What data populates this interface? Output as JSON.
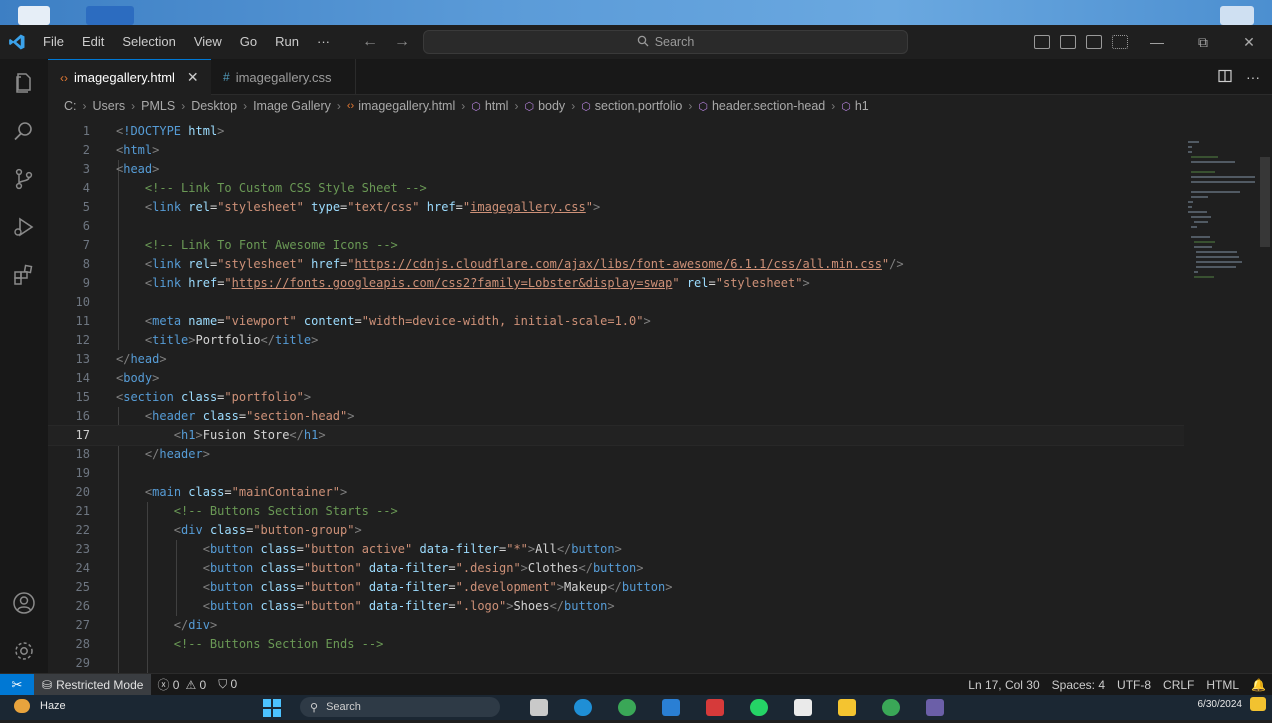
{
  "titlebar": {
    "menus": [
      "File",
      "Edit",
      "Selection",
      "View",
      "Go",
      "Run",
      "···"
    ],
    "search_label": "Search",
    "back_arrow": "←",
    "forward_arrow": "→"
  },
  "tabs": [
    {
      "label": "imagegallery.html",
      "icon": "‹›",
      "active": true
    },
    {
      "label": "imagegallery.css",
      "icon": "#",
      "active": false
    }
  ],
  "breadcrumb": [
    "C:",
    "Users",
    "PMLS",
    "Desktop",
    "Image Gallery",
    "imagegallery.html",
    "html",
    "body",
    "section.portfolio",
    "header.section-head",
    "h1"
  ],
  "editor": {
    "current_line": 17,
    "lines": [
      {
        "n": "1",
        "tokens": [
          [
            "t-tag",
            "<"
          ],
          [
            "t-doc",
            "!DOCTYPE"
          ],
          [
            "t-txt",
            " "
          ],
          [
            "t-attr",
            "html"
          ],
          [
            "t-tag",
            ">"
          ]
        ]
      },
      {
        "n": "2",
        "tokens": [
          [
            "t-tag",
            "<"
          ],
          [
            "t-name",
            "html"
          ],
          [
            "t-tag",
            ">"
          ]
        ]
      },
      {
        "n": "3",
        "tokens": [
          [
            "t-tag",
            "<"
          ],
          [
            "t-name",
            "head"
          ],
          [
            "t-tag",
            ">"
          ]
        ]
      },
      {
        "n": "4",
        "tokens": [
          [
            "t-txt",
            "    "
          ],
          [
            "t-com",
            "<!-- Link To Custom CSS Style Sheet -->"
          ]
        ]
      },
      {
        "n": "5",
        "tokens": [
          [
            "t-txt",
            "    "
          ],
          [
            "t-tag",
            "<"
          ],
          [
            "t-name",
            "link"
          ],
          [
            "t-txt",
            " "
          ],
          [
            "t-attr",
            "rel"
          ],
          [
            "t-txt",
            "="
          ],
          [
            "t-str",
            "\"stylesheet\""
          ],
          [
            "t-txt",
            " "
          ],
          [
            "t-attr",
            "type"
          ],
          [
            "t-txt",
            "="
          ],
          [
            "t-str",
            "\"text/css\""
          ],
          [
            "t-txt",
            " "
          ],
          [
            "t-attr",
            "href"
          ],
          [
            "t-txt",
            "="
          ],
          [
            "t-str",
            "\""
          ],
          [
            "t-link",
            "imagegallery.css"
          ],
          [
            "t-str",
            "\""
          ],
          [
            "t-tag",
            ">"
          ]
        ]
      },
      {
        "n": "6",
        "tokens": []
      },
      {
        "n": "7",
        "tokens": [
          [
            "t-txt",
            "    "
          ],
          [
            "t-com",
            "<!-- Link To Font Awesome Icons -->"
          ]
        ]
      },
      {
        "n": "8",
        "tokens": [
          [
            "t-txt",
            "    "
          ],
          [
            "t-tag",
            "<"
          ],
          [
            "t-name",
            "link"
          ],
          [
            "t-txt",
            " "
          ],
          [
            "t-attr",
            "rel"
          ],
          [
            "t-txt",
            "="
          ],
          [
            "t-str",
            "\"stylesheet\""
          ],
          [
            "t-txt",
            " "
          ],
          [
            "t-attr",
            "href"
          ],
          [
            "t-txt",
            "="
          ],
          [
            "t-str",
            "\""
          ],
          [
            "t-link",
            "https://cdnjs.cloudflare.com/ajax/libs/font-awesome/6.1.1/css/all.min.css"
          ],
          [
            "t-str",
            "\""
          ],
          [
            "t-tag",
            "/>"
          ]
        ]
      },
      {
        "n": "9",
        "tokens": [
          [
            "t-txt",
            "    "
          ],
          [
            "t-tag",
            "<"
          ],
          [
            "t-name",
            "link"
          ],
          [
            "t-txt",
            " "
          ],
          [
            "t-attr",
            "href"
          ],
          [
            "t-txt",
            "="
          ],
          [
            "t-str",
            "\""
          ],
          [
            "t-link",
            "https://fonts.googleapis.com/css2?family=Lobster&display=swap"
          ],
          [
            "t-str",
            "\""
          ],
          [
            "t-txt",
            " "
          ],
          [
            "t-attr",
            "rel"
          ],
          [
            "t-txt",
            "="
          ],
          [
            "t-str",
            "\"stylesheet\""
          ],
          [
            "t-tag",
            ">"
          ]
        ]
      },
      {
        "n": "10",
        "tokens": []
      },
      {
        "n": "11",
        "tokens": [
          [
            "t-txt",
            "    "
          ],
          [
            "t-tag",
            "<"
          ],
          [
            "t-name",
            "meta"
          ],
          [
            "t-txt",
            " "
          ],
          [
            "t-attr",
            "name"
          ],
          [
            "t-txt",
            "="
          ],
          [
            "t-str",
            "\"viewport\""
          ],
          [
            "t-txt",
            " "
          ],
          [
            "t-attr",
            "content"
          ],
          [
            "t-txt",
            "="
          ],
          [
            "t-str",
            "\"width=device-width, initial-scale=1.0\""
          ],
          [
            "t-tag",
            ">"
          ]
        ]
      },
      {
        "n": "12",
        "tokens": [
          [
            "t-txt",
            "    "
          ],
          [
            "t-tag",
            "<"
          ],
          [
            "t-name",
            "title"
          ],
          [
            "t-tag",
            ">"
          ],
          [
            "t-txt",
            "Portfolio"
          ],
          [
            "t-tag",
            "</"
          ],
          [
            "t-name",
            "title"
          ],
          [
            "t-tag",
            ">"
          ]
        ]
      },
      {
        "n": "13",
        "tokens": [
          [
            "t-tag",
            "</"
          ],
          [
            "t-name",
            "head"
          ],
          [
            "t-tag",
            ">"
          ]
        ]
      },
      {
        "n": "14",
        "tokens": [
          [
            "t-tag",
            "<"
          ],
          [
            "t-name",
            "body"
          ],
          [
            "t-tag",
            ">"
          ]
        ]
      },
      {
        "n": "15",
        "tokens": [
          [
            "t-tag",
            "<"
          ],
          [
            "t-name",
            "section"
          ],
          [
            "t-txt",
            " "
          ],
          [
            "t-attr",
            "class"
          ],
          [
            "t-txt",
            "="
          ],
          [
            "t-str",
            "\"portfolio\""
          ],
          [
            "t-tag",
            ">"
          ]
        ]
      },
      {
        "n": "16",
        "tokens": [
          [
            "t-txt",
            "    "
          ],
          [
            "t-tag",
            "<"
          ],
          [
            "t-name",
            "header"
          ],
          [
            "t-txt",
            " "
          ],
          [
            "t-attr",
            "class"
          ],
          [
            "t-txt",
            "="
          ],
          [
            "t-str",
            "\"section-head\""
          ],
          [
            "t-tag",
            ">"
          ]
        ]
      },
      {
        "n": "17",
        "tokens": [
          [
            "t-txt",
            "        "
          ],
          [
            "t-tag",
            "<"
          ],
          [
            "t-name",
            "h1"
          ],
          [
            "t-tag",
            ">"
          ],
          [
            "t-txt",
            "Fusion Store"
          ],
          [
            "t-tag",
            "</"
          ],
          [
            "t-name",
            "h1"
          ],
          [
            "t-tag",
            ">"
          ]
        ]
      },
      {
        "n": "18",
        "tokens": [
          [
            "t-txt",
            "    "
          ],
          [
            "t-tag",
            "</"
          ],
          [
            "t-name",
            "header"
          ],
          [
            "t-tag",
            ">"
          ]
        ]
      },
      {
        "n": "19",
        "tokens": []
      },
      {
        "n": "20",
        "tokens": [
          [
            "t-txt",
            "    "
          ],
          [
            "t-tag",
            "<"
          ],
          [
            "t-name",
            "main"
          ],
          [
            "t-txt",
            " "
          ],
          [
            "t-attr",
            "class"
          ],
          [
            "t-txt",
            "="
          ],
          [
            "t-str",
            "\"mainContainer\""
          ],
          [
            "t-tag",
            ">"
          ]
        ]
      },
      {
        "n": "21",
        "tokens": [
          [
            "t-txt",
            "        "
          ],
          [
            "t-com",
            "<!-- Buttons Section Starts -->"
          ]
        ]
      },
      {
        "n": "22",
        "tokens": [
          [
            "t-txt",
            "        "
          ],
          [
            "t-tag",
            "<"
          ],
          [
            "t-name",
            "div"
          ],
          [
            "t-txt",
            " "
          ],
          [
            "t-attr",
            "class"
          ],
          [
            "t-txt",
            "="
          ],
          [
            "t-str",
            "\"button-group\""
          ],
          [
            "t-tag",
            ">"
          ]
        ]
      },
      {
        "n": "23",
        "tokens": [
          [
            "t-txt",
            "            "
          ],
          [
            "t-tag",
            "<"
          ],
          [
            "t-name",
            "button"
          ],
          [
            "t-txt",
            " "
          ],
          [
            "t-attr",
            "class"
          ],
          [
            "t-txt",
            "="
          ],
          [
            "t-str",
            "\"button active\""
          ],
          [
            "t-txt",
            " "
          ],
          [
            "t-attr",
            "data-filter"
          ],
          [
            "t-txt",
            "="
          ],
          [
            "t-str",
            "\"*\""
          ],
          [
            "t-tag",
            ">"
          ],
          [
            "t-txt",
            "All"
          ],
          [
            "t-tag",
            "</"
          ],
          [
            "t-name",
            "button"
          ],
          [
            "t-tag",
            ">"
          ]
        ]
      },
      {
        "n": "24",
        "tokens": [
          [
            "t-txt",
            "            "
          ],
          [
            "t-tag",
            "<"
          ],
          [
            "t-name",
            "button"
          ],
          [
            "t-txt",
            " "
          ],
          [
            "t-attr",
            "class"
          ],
          [
            "t-txt",
            "="
          ],
          [
            "t-str",
            "\"button\""
          ],
          [
            "t-txt",
            " "
          ],
          [
            "t-attr",
            "data-filter"
          ],
          [
            "t-txt",
            "="
          ],
          [
            "t-str",
            "\".design\""
          ],
          [
            "t-tag",
            ">"
          ],
          [
            "t-txt",
            "Clothes"
          ],
          [
            "t-tag",
            "</"
          ],
          [
            "t-name",
            "button"
          ],
          [
            "t-tag",
            ">"
          ]
        ]
      },
      {
        "n": "25",
        "tokens": [
          [
            "t-txt",
            "            "
          ],
          [
            "t-tag",
            "<"
          ],
          [
            "t-name",
            "button"
          ],
          [
            "t-txt",
            " "
          ],
          [
            "t-attr",
            "class"
          ],
          [
            "t-txt",
            "="
          ],
          [
            "t-str",
            "\"button\""
          ],
          [
            "t-txt",
            " "
          ],
          [
            "t-attr",
            "data-filter"
          ],
          [
            "t-txt",
            "="
          ],
          [
            "t-str",
            "\".development\""
          ],
          [
            "t-tag",
            ">"
          ],
          [
            "t-txt",
            "Makeup"
          ],
          [
            "t-tag",
            "</"
          ],
          [
            "t-name",
            "button"
          ],
          [
            "t-tag",
            ">"
          ]
        ]
      },
      {
        "n": "26",
        "tokens": [
          [
            "t-txt",
            "            "
          ],
          [
            "t-tag",
            "<"
          ],
          [
            "t-name",
            "button"
          ],
          [
            "t-txt",
            " "
          ],
          [
            "t-attr",
            "class"
          ],
          [
            "t-txt",
            "="
          ],
          [
            "t-str",
            "\"button\""
          ],
          [
            "t-txt",
            " "
          ],
          [
            "t-attr",
            "data-filter"
          ],
          [
            "t-txt",
            "="
          ],
          [
            "t-str",
            "\".logo\""
          ],
          [
            "t-tag",
            ">"
          ],
          [
            "t-txt",
            "Shoes"
          ],
          [
            "t-tag",
            "</"
          ],
          [
            "t-name",
            "button"
          ],
          [
            "t-tag",
            ">"
          ]
        ]
      },
      {
        "n": "27",
        "tokens": [
          [
            "t-txt",
            "        "
          ],
          [
            "t-tag",
            "</"
          ],
          [
            "t-name",
            "div"
          ],
          [
            "t-tag",
            ">"
          ]
        ]
      },
      {
        "n": "28",
        "tokens": [
          [
            "t-txt",
            "        "
          ],
          [
            "t-com",
            "<!-- Buttons Section Ends -->"
          ]
        ]
      },
      {
        "n": "29",
        "tokens": []
      }
    ]
  },
  "statusbar": {
    "remote_icon": "✂",
    "restricted_mode": "Restricted Mode",
    "errors": "ⓧ 0",
    "warnings": "⚠ 0",
    "ports": "⛉ 0",
    "position": "Ln 17, Col 30",
    "spaces": "Spaces: 4",
    "encoding": "UTF-8",
    "eol": "CRLF",
    "language": "HTML"
  },
  "taskbar": {
    "weather": "Haze",
    "search": "Search",
    "date": "6/30/2024"
  },
  "colors": {
    "accent": "#0078d4",
    "editor_bg": "#1f1f1f",
    "sidebar_bg": "#181818",
    "restricted_bg": "#3a3d41"
  }
}
